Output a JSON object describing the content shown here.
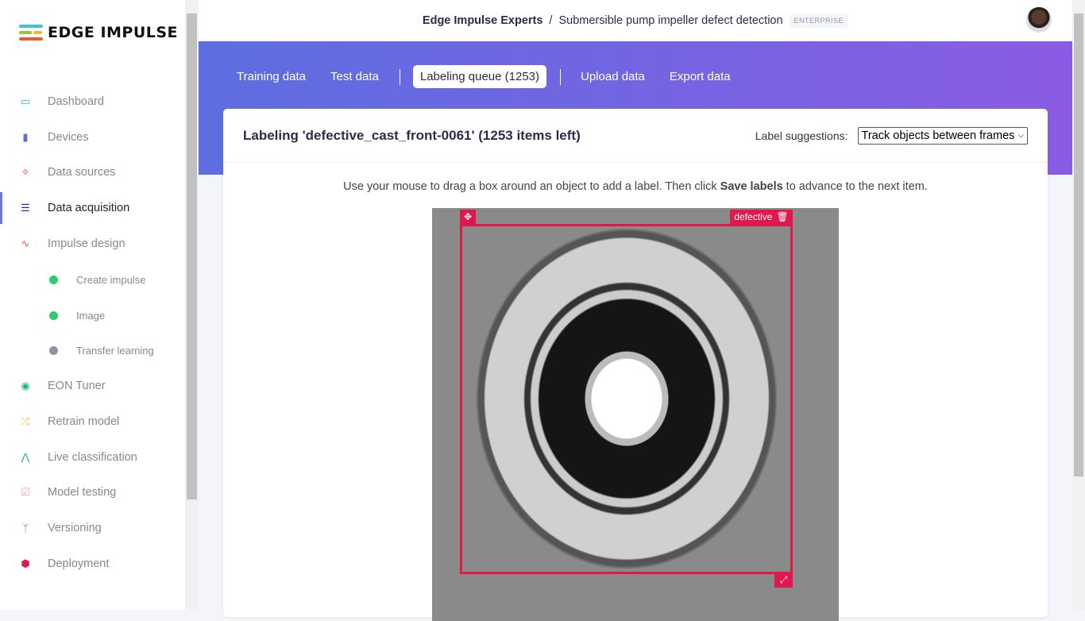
{
  "brand": {
    "name": "EDGE IMPULSE"
  },
  "header": {
    "org": "Edge Impulse Experts",
    "separator": "/",
    "project": "Submersible pump impeller defect detection",
    "badge": "ENTERPRISE"
  },
  "sidebar": {
    "items": [
      {
        "label": "Dashboard",
        "icon": "monitor-icon",
        "color": "#1fc1e0"
      },
      {
        "label": "Devices",
        "icon": "chip-icon",
        "color": "#5d6ee0"
      },
      {
        "label": "Data sources",
        "icon": "magic-wand-icon",
        "color": "#e8335a"
      },
      {
        "label": "Data acquisition",
        "icon": "database-icon",
        "color": "#4b1aa5",
        "active": true
      },
      {
        "label": "Impulse design",
        "icon": "pulse-icon",
        "color": "#ee5a3a"
      },
      {
        "label": "Create impulse",
        "icon": "dot-icon",
        "color": "#2ecc71"
      },
      {
        "label": "Image",
        "icon": "dot-icon",
        "color": "#2ecc71"
      },
      {
        "label": "Transfer learning",
        "icon": "dot-icon",
        "color": "#8b93a5"
      },
      {
        "label": "EON Tuner",
        "icon": "compass-icon",
        "color": "#1bb98f"
      },
      {
        "label": "Retrain model",
        "icon": "shuffle-icon",
        "color": "#f0c419"
      },
      {
        "label": "Live classification",
        "icon": "graph-icon",
        "color": "#1bb98f"
      },
      {
        "label": "Model testing",
        "icon": "clipboard-check-icon",
        "color": "#f59ab0"
      },
      {
        "label": "Versioning",
        "icon": "branch-icon",
        "color": "#5d6ee0"
      },
      {
        "label": "Deployment",
        "icon": "cube-icon",
        "color": "#e0184c"
      }
    ]
  },
  "tabs": [
    {
      "label": "Training data"
    },
    {
      "label": "Test data"
    },
    {
      "label": "Labeling queue (1253)",
      "active": true
    },
    {
      "label": "Upload data"
    },
    {
      "label": "Export data"
    }
  ],
  "labeling": {
    "title": "Labeling 'defective_cast_front-0061' (1253 items left)",
    "suggestions_label": "Label suggestions:",
    "suggestions_value": "Track objects between frames",
    "instr_pre": "Use your mouse to drag a box around an object to add a label. Then click ",
    "instr_bold": "Save labels",
    "instr_post": " to advance to the next item.",
    "box_label": "defective",
    "box_color": "#e0184c"
  }
}
